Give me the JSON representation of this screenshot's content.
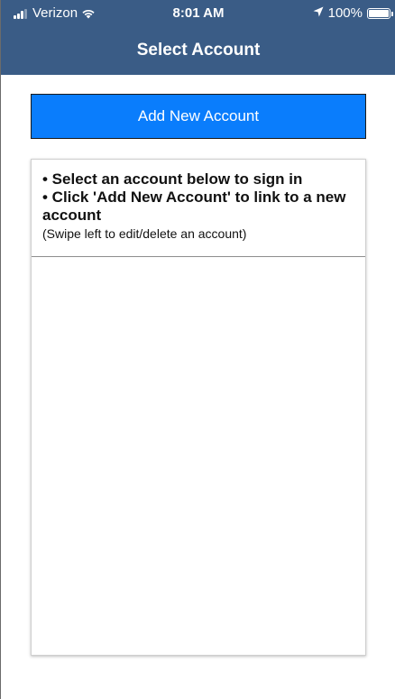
{
  "status_bar": {
    "carrier": "Verizon",
    "time": "8:01 AM",
    "battery": "100%"
  },
  "nav": {
    "title": "Select Account"
  },
  "add_button": {
    "label": "Add New Account"
  },
  "instructions": {
    "line1": "• Select an account below to sign in",
    "line2": "• Click 'Add New Account' to link to a new account",
    "note": "(Swipe left to edit/delete an account)"
  },
  "colors": {
    "header": "#3a5c86",
    "button": "#0a7dfc"
  },
  "icons": {
    "signal": "cellular-signal-icon",
    "wifi": "wifi-icon",
    "location": "location-arrow-icon",
    "battery": "battery-icon"
  }
}
